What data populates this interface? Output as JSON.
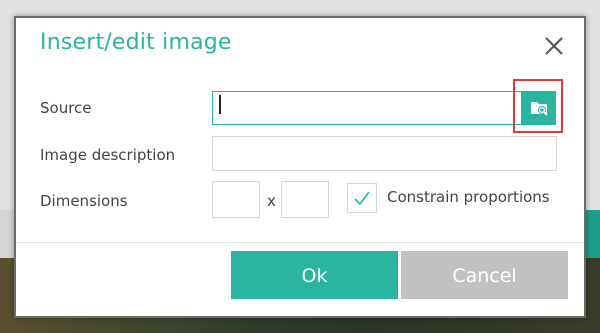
{
  "dialog": {
    "title": "Insert/edit image",
    "close_icon": "close-icon",
    "fields": {
      "source_label": "Source",
      "source_value": "",
      "browse_icon": "folder-search-icon",
      "description_label": "Image description",
      "description_value": "",
      "dimensions_label": "Dimensions",
      "width_value": "",
      "height_value": "",
      "separator": "x",
      "constrain_label": "Constrain proportions",
      "constrain_checked": true
    },
    "buttons": {
      "ok": "Ok",
      "cancel": "Cancel"
    }
  },
  "colors": {
    "accent": "#2ab5a0",
    "cancel": "#c2c2c2",
    "highlight": "#e53935"
  }
}
